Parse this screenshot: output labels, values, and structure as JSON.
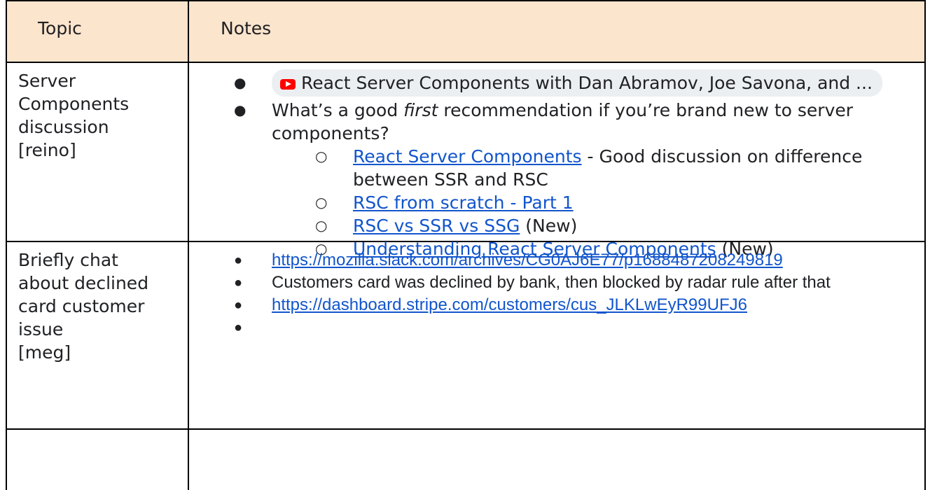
{
  "table": {
    "header": {
      "topic": "Topic",
      "notes": "Notes"
    },
    "rows": [
      {
        "topic": "Server\nComponents\ndiscussion\n[reino]",
        "chip_text": "React Server Components with Dan Abramov, Joe Savona, and ...",
        "q_before": "What’s a good ",
        "q_em": "first",
        "q_after": " recommendation if you’re brand new to server components?",
        "links": [
          {
            "label": "React Server Components",
            "suffix": " - Good discussion on difference between SSR and RSC"
          },
          {
            "label": "RSC from scratch - Part 1",
            "suffix": ""
          },
          {
            "label": "RSC vs SSR vs SSG",
            "suffix": " (New)"
          },
          {
            "label": "Understanding React Server Components",
            "suffix": " (New)"
          }
        ]
      },
      {
        "topic": "Briefly chat\nabout declined\ncard customer\nissue\n[meg]",
        "slack_link": "https://mozilla.slack.com/archives/CG0AJ6E77/p1688487208249819",
        "note": "Customers card was declined by bank, then blocked by radar rule after that",
        "stripe_link": "https://dashboard.stripe.com/customers/cus_JLKLwEyR99UFJ6",
        "empty_bullet": ""
      },
      {
        "topic": "",
        "notes": ""
      }
    ]
  },
  "colors": {
    "header_bg": "#fce5cd",
    "link": "#1155cc",
    "youtube_red": "#ff0000",
    "chip_bg": "#eceff1"
  }
}
